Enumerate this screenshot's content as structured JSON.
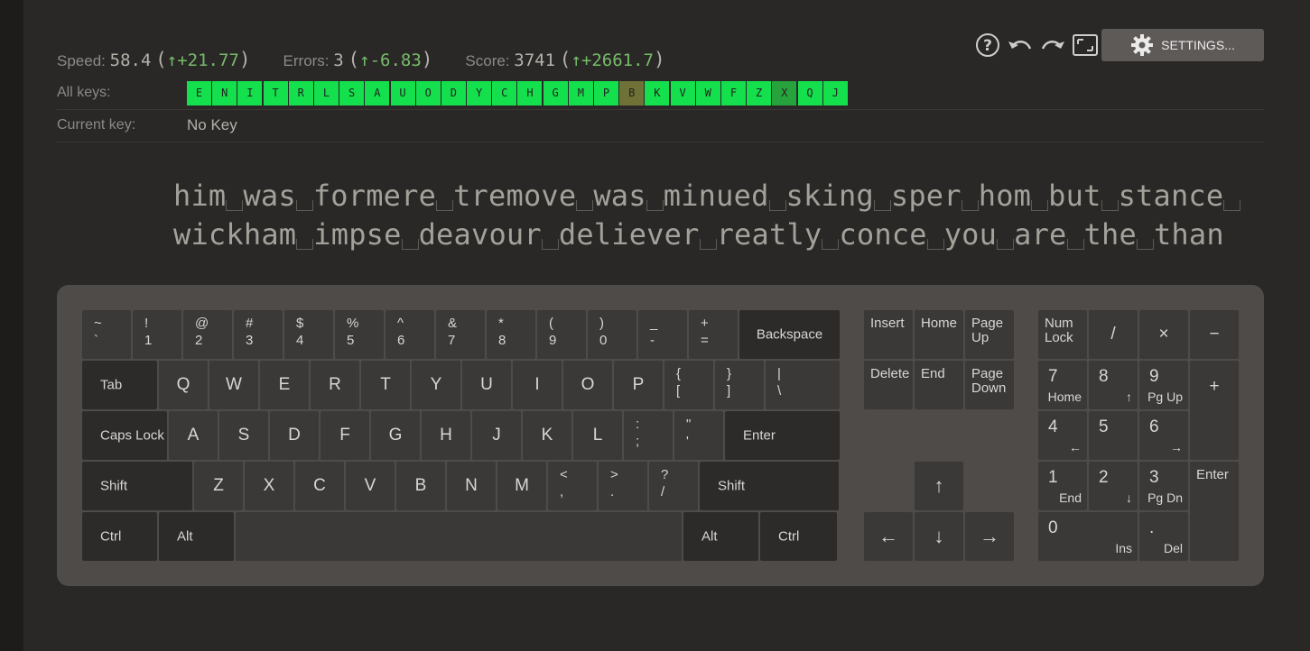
{
  "stats": {
    "speed": {
      "label": "Speed:",
      "value": "58.4",
      "delta": "+21.77"
    },
    "errors": {
      "label": "Errors:",
      "value": "3",
      "delta": "-6.83"
    },
    "score": {
      "label": "Score:",
      "value": "3741",
      "delta": "+2661.7"
    }
  },
  "toolbar": {
    "settings_label": "SETTINGS..."
  },
  "all_keys": {
    "label": "All keys:",
    "keys": [
      {
        "char": "E",
        "color": "#14e04e"
      },
      {
        "char": "N",
        "color": "#14e04e"
      },
      {
        "char": "I",
        "color": "#14e04e"
      },
      {
        "char": "T",
        "color": "#14e04e"
      },
      {
        "char": "R",
        "color": "#14e04e"
      },
      {
        "char": "L",
        "color": "#14e04e"
      },
      {
        "char": "S",
        "color": "#14e04e"
      },
      {
        "char": "A",
        "color": "#14e04e"
      },
      {
        "char": "U",
        "color": "#14e04e"
      },
      {
        "char": "O",
        "color": "#14e04e"
      },
      {
        "char": "D",
        "color": "#14e04e"
      },
      {
        "char": "Y",
        "color": "#14e04e"
      },
      {
        "char": "C",
        "color": "#14e04e"
      },
      {
        "char": "H",
        "color": "#14e04e"
      },
      {
        "char": "G",
        "color": "#14e04e"
      },
      {
        "char": "M",
        "color": "#14e04e"
      },
      {
        "char": "P",
        "color": "#14e04e"
      },
      {
        "char": "B",
        "color": "#6f7136"
      },
      {
        "char": "K",
        "color": "#14e04e"
      },
      {
        "char": "V",
        "color": "#14e04e"
      },
      {
        "char": "W",
        "color": "#14e04e"
      },
      {
        "char": "F",
        "color": "#14e04e"
      },
      {
        "char": "Z",
        "color": "#14e04e"
      },
      {
        "char": "X",
        "color": "#27a33d"
      },
      {
        "char": "Q",
        "color": "#14e04e"
      },
      {
        "char": "J",
        "color": "#14e04e"
      }
    ]
  },
  "current_key": {
    "label": "Current key:",
    "value": "No Key"
  },
  "practice_text": {
    "lines": [
      [
        "him",
        "was",
        "formere",
        "tremove",
        "was",
        "minued",
        "sking",
        "sper",
        "hom",
        "but",
        "stance"
      ],
      [
        "wickham",
        "impse",
        "deavour",
        "deliever",
        "reatly",
        "conce",
        "you",
        "are",
        "the",
        "than"
      ]
    ]
  },
  "keyboard": {
    "main_rows": [
      [
        {
          "t": "~",
          "b": "`"
        },
        {
          "t": "!",
          "b": "1"
        },
        {
          "t": "@",
          "b": "2"
        },
        {
          "t": "#",
          "b": "3"
        },
        {
          "t": "$",
          "b": "4"
        },
        {
          "t": "%",
          "b": "5"
        },
        {
          "t": "^",
          "b": "6"
        },
        {
          "t": "&",
          "b": "7"
        },
        {
          "t": "*",
          "b": "8"
        },
        {
          "t": "(",
          "b": "9"
        },
        {
          "t": ")",
          "b": "0"
        },
        {
          "t": "_",
          "b": "-"
        },
        {
          "t": "+",
          "b": "="
        },
        {
          "label": "Backspace"
        }
      ],
      [
        {
          "label": "Tab"
        },
        {
          "l": "Q"
        },
        {
          "l": "W"
        },
        {
          "l": "E"
        },
        {
          "l": "R"
        },
        {
          "l": "T"
        },
        {
          "l": "Y"
        },
        {
          "l": "U"
        },
        {
          "l": "I"
        },
        {
          "l": "O"
        },
        {
          "l": "P"
        },
        {
          "t": "{",
          "b": "["
        },
        {
          "t": "}",
          "b": "]"
        },
        {
          "t": "|",
          "b": "\\"
        }
      ],
      [
        {
          "label": "Caps Lock"
        },
        {
          "l": "A"
        },
        {
          "l": "S"
        },
        {
          "l": "D"
        },
        {
          "l": "F"
        },
        {
          "l": "G"
        },
        {
          "l": "H"
        },
        {
          "l": "J"
        },
        {
          "l": "K"
        },
        {
          "l": "L"
        },
        {
          "t": ":",
          "b": ";"
        },
        {
          "t": "\"",
          "b": "'"
        },
        {
          "label": "Enter"
        }
      ],
      [
        {
          "label": "Shift"
        },
        {
          "l": "Z"
        },
        {
          "l": "X"
        },
        {
          "l": "C"
        },
        {
          "l": "V"
        },
        {
          "l": "B"
        },
        {
          "l": "N"
        },
        {
          "l": "M"
        },
        {
          "t": "<",
          "b": ","
        },
        {
          "t": ">",
          "b": "."
        },
        {
          "t": "?",
          "b": "/"
        },
        {
          "label": "Shift"
        }
      ],
      [
        {
          "label": "Ctrl"
        },
        {
          "label": "Alt"
        },
        {
          "label": ""
        },
        {
          "label": "Alt"
        },
        {
          "label": "Ctrl"
        }
      ]
    ],
    "nav": [
      "Insert",
      "Home",
      "Page\nUp",
      "Delete",
      "End",
      "Page\nDown"
    ],
    "arrows": {
      "up": "↑",
      "left": "←",
      "down": "↓",
      "right": "→"
    },
    "numpad": {
      "numlock": "Num\nLock",
      "divide": "/",
      "multiply": "×",
      "minus": "−",
      "plus": "+",
      "enter": "Enter",
      "n7": [
        "7",
        "Home"
      ],
      "n8": [
        "8",
        "↑"
      ],
      "n9": [
        "9",
        "Pg Up"
      ],
      "n4": [
        "4",
        "←"
      ],
      "n5": [
        "5",
        ""
      ],
      "n6": [
        "6",
        "→"
      ],
      "n1": [
        "1",
        "End"
      ],
      "n2": [
        "2",
        "↓"
      ],
      "n3": [
        "3",
        "Pg Dn"
      ],
      "n0": [
        "0",
        "Ins"
      ],
      "ndot": [
        ".",
        "Del"
      ]
    }
  }
}
